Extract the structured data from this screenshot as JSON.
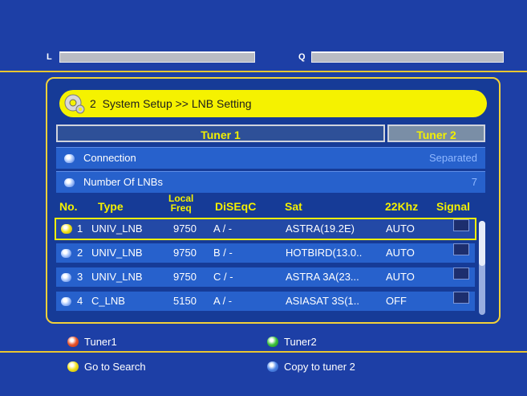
{
  "meters": {
    "l_label": "L",
    "q_label": "Q"
  },
  "title_bar": {
    "number": "2",
    "text": "System Setup >> LNB Setting"
  },
  "tabs": {
    "tuner1": "Tuner 1",
    "tuner2": "Tuner 2",
    "active": "tuner1"
  },
  "settings": {
    "connection": {
      "label": "Connection",
      "value": "Separated"
    },
    "number_of_lnbs": {
      "label": "Number Of LNBs",
      "value": "7"
    }
  },
  "table": {
    "headers": {
      "no": "No.",
      "type": "Type",
      "local_freq_1": "Local",
      "local_freq_2": "Freq",
      "diseqc": "DiSEqC",
      "sat": "Sat",
      "khz22": "22Khz",
      "signal": "Signal"
    },
    "rows": [
      {
        "no": "1",
        "type": "UNIV_LNB",
        "freq": "9750",
        "diseqc": "A / -",
        "sat": "ASTRA(19.2E)",
        "khz22": "AUTO",
        "selected": true
      },
      {
        "no": "2",
        "type": "UNIV_LNB",
        "freq": "9750",
        "diseqc": "B / -",
        "sat": "HOTBIRD(13.0..",
        "khz22": "AUTO",
        "selected": false
      },
      {
        "no": "3",
        "type": "UNIV_LNB",
        "freq": "9750",
        "diseqc": "C / -",
        "sat": "ASTRA 3A(23...",
        "khz22": "AUTO",
        "selected": false
      },
      {
        "no": "4",
        "type": "C_LNB",
        "freq": "5150",
        "diseqc": "A / -",
        "sat": "ASIASAT 3S(1..",
        "khz22": "OFF",
        "selected": false
      }
    ]
  },
  "legend": {
    "red": "Tuner1",
    "green": "Tuner2",
    "yellow": "Go to Search",
    "blue": "Copy to tuner 2"
  },
  "colors": {
    "background": "#1d3fa6",
    "accent_yellow": "#f5f200",
    "row_blue": "#2761cc",
    "red": "#e8542a",
    "green": "#3ec23e",
    "yellow": "#f2e21a",
    "blue": "#4f86e8"
  }
}
